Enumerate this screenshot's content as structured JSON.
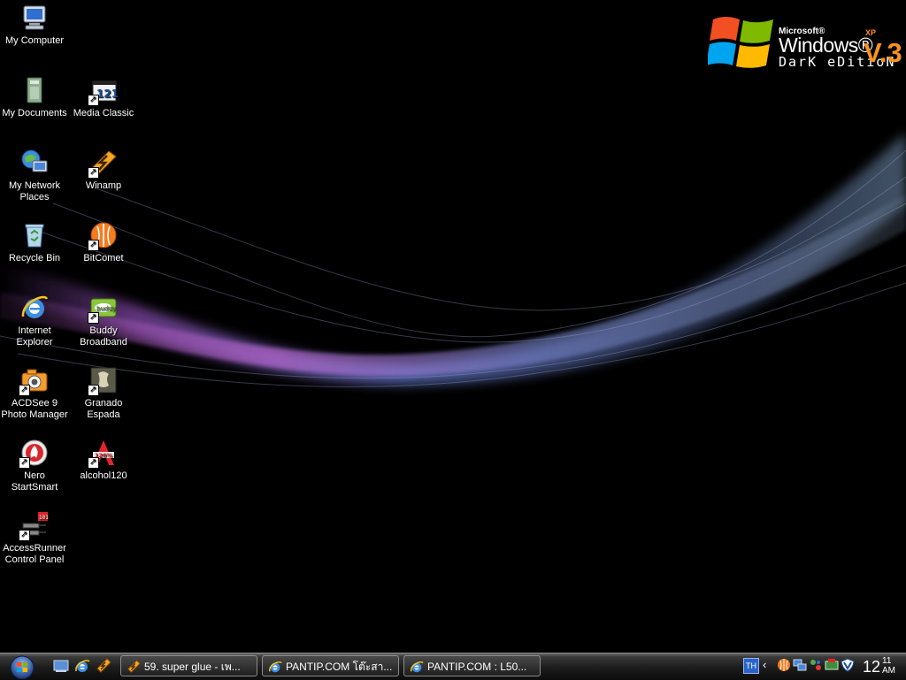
{
  "logo": {
    "microsoft": "Microsoft®",
    "windows": "Windows®",
    "xp": "XP",
    "edition": "DarK eDitioN",
    "version": "V.3"
  },
  "desktop_icons": [
    {
      "id": "my-computer",
      "label": "My Computer"
    },
    {
      "id": "my-documents",
      "label": "My Documents"
    },
    {
      "id": "media-classic",
      "label": "Media Classic"
    },
    {
      "id": "my-network-places",
      "label": "My Network Places"
    },
    {
      "id": "winamp",
      "label": "Winamp"
    },
    {
      "id": "recycle-bin",
      "label": "Recycle Bin"
    },
    {
      "id": "bitcomet",
      "label": "BitComet"
    },
    {
      "id": "internet-explorer",
      "label": "Internet Explorer"
    },
    {
      "id": "buddy-broadband",
      "label": "Buddy Broadband"
    },
    {
      "id": "acdsee",
      "label": "ACDSee 9 Photo Manager"
    },
    {
      "id": "granado-espada",
      "label": "Granado Espada"
    },
    {
      "id": "nero",
      "label": "Nero StartSmart"
    },
    {
      "id": "alcohol120",
      "label": "alcohol120"
    },
    {
      "id": "accessrunner",
      "label": "AccessRunner Control Panel"
    }
  ],
  "taskbar": {
    "start_icon": "windows-orb-icon",
    "quick_launch": [
      "show-desktop-icon",
      "internet-explorer-icon",
      "winamp-icon"
    ],
    "tasks": [
      {
        "label": "59. super glue - เพ...",
        "icon": "winamp-icon"
      },
      {
        "label": "PANTIP.COM โต๊ะสา...",
        "icon": "internet-explorer-icon"
      },
      {
        "label": "PANTIP.COM : L50...",
        "icon": "internet-explorer-icon"
      }
    ],
    "tray": {
      "language": "TH",
      "icons": [
        "chevron-left-icon",
        "bitcomet-icon",
        "network-icon",
        "network-status-icon",
        "security-icon",
        "antivirus-icon"
      ]
    },
    "clock": {
      "hour": "12",
      "minute": "11",
      "ampm": "AM"
    }
  }
}
